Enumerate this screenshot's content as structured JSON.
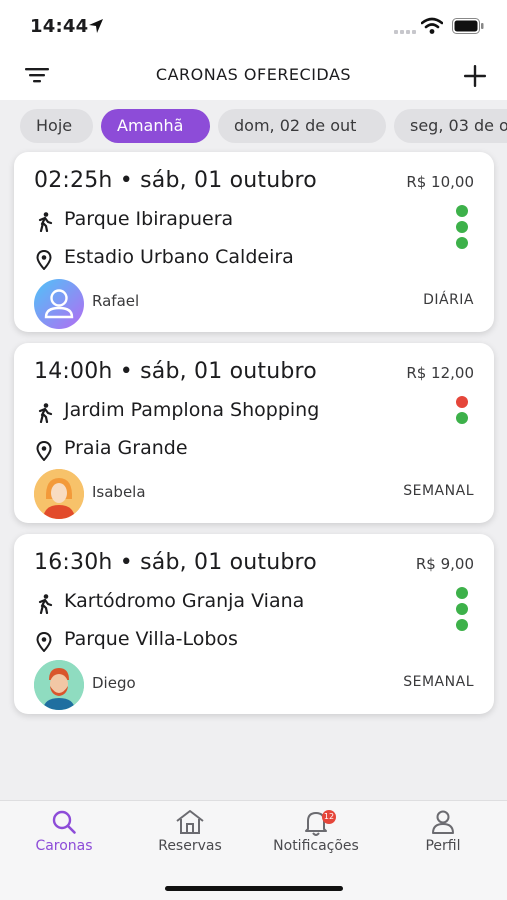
{
  "status_bar": {
    "time": "14:44"
  },
  "header": {
    "title": "CARONAS OFERECIDAS"
  },
  "date_chips": [
    "Hoje",
    "Amanhã",
    "dom, 02 de out",
    "seg, 03 de out"
  ],
  "rides": [
    {
      "time": "02:25h • sáb, 01 outubro",
      "price": "R$ 10,00",
      "origin": "Parque Ibirapuera",
      "destination": "Estadio Urbano Caldeira",
      "driver": "Rafael",
      "frequency": "DIÁRIA",
      "seats": [
        "#3db14a",
        "#3db14a",
        "#3db14a"
      ]
    },
    {
      "time": "14:00h • sáb, 01 outubro",
      "price": "R$ 12,00",
      "origin": "Jardim Pamplona Shopping",
      "destination": "Praia Grande",
      "driver": "Isabela",
      "frequency": "SEMANAL",
      "seats": [
        "#e5463a",
        "#3db14a"
      ]
    },
    {
      "time": "16:30h • sáb, 01 outubro",
      "price": "R$ 9,00",
      "origin": "Kartódromo Granja Viana",
      "destination": "Parque Villa-Lobos",
      "driver": "Diego",
      "frequency": "SEMANAL",
      "seats": [
        "#3db14a",
        "#3db14a",
        "#3db14a"
      ]
    }
  ],
  "tabs": [
    {
      "label": "Caronas",
      "icon": "search-icon"
    },
    {
      "label": "Reservas",
      "icon": "home-icon"
    },
    {
      "label": "Notificações",
      "icon": "bell-icon",
      "badge": "12"
    },
    {
      "label": "Perfil",
      "icon": "person-icon"
    }
  ],
  "colors": {
    "accent": "#8d4cd8",
    "seat_available": "#3db14a",
    "seat_taken": "#e5463a"
  }
}
